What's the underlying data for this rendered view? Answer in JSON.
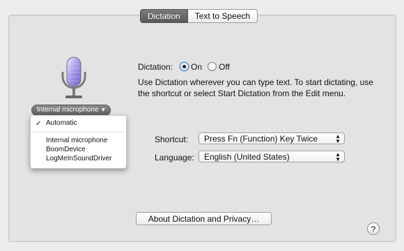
{
  "tabs": [
    {
      "label": "Dictation",
      "active": true
    },
    {
      "label": "Text to Speech",
      "active": false
    }
  ],
  "mic_source": {
    "selected": "Internal microphone",
    "menu_items": [
      "Automatic",
      "Internal microphone",
      "BoomDevice",
      "LogMeInSoundDriver"
    ],
    "checked_item": "Automatic"
  },
  "dictation": {
    "label": "Dictation:",
    "on_label": "On",
    "off_label": "Off",
    "value": "On",
    "description": "Use Dictation wherever you can type text. To start dictating, use the shortcut or select Start Dictation from the Edit menu."
  },
  "shortcut": {
    "label": "Shortcut:",
    "value": "Press Fn (Function) Key Twice"
  },
  "language": {
    "label": "Language:",
    "value": "English (United States)"
  },
  "about_button": "About Dictation and Privacy…",
  "help_glyph": "?",
  "colors": {
    "accent": "#3b78c6",
    "panel": "#e3e3e3",
    "window": "#ececec"
  },
  "icons": [
    "microphone-icon",
    "help-icon",
    "checkmark-icon",
    "popup-arrows-icon",
    "dropdown-caret-icon"
  ]
}
